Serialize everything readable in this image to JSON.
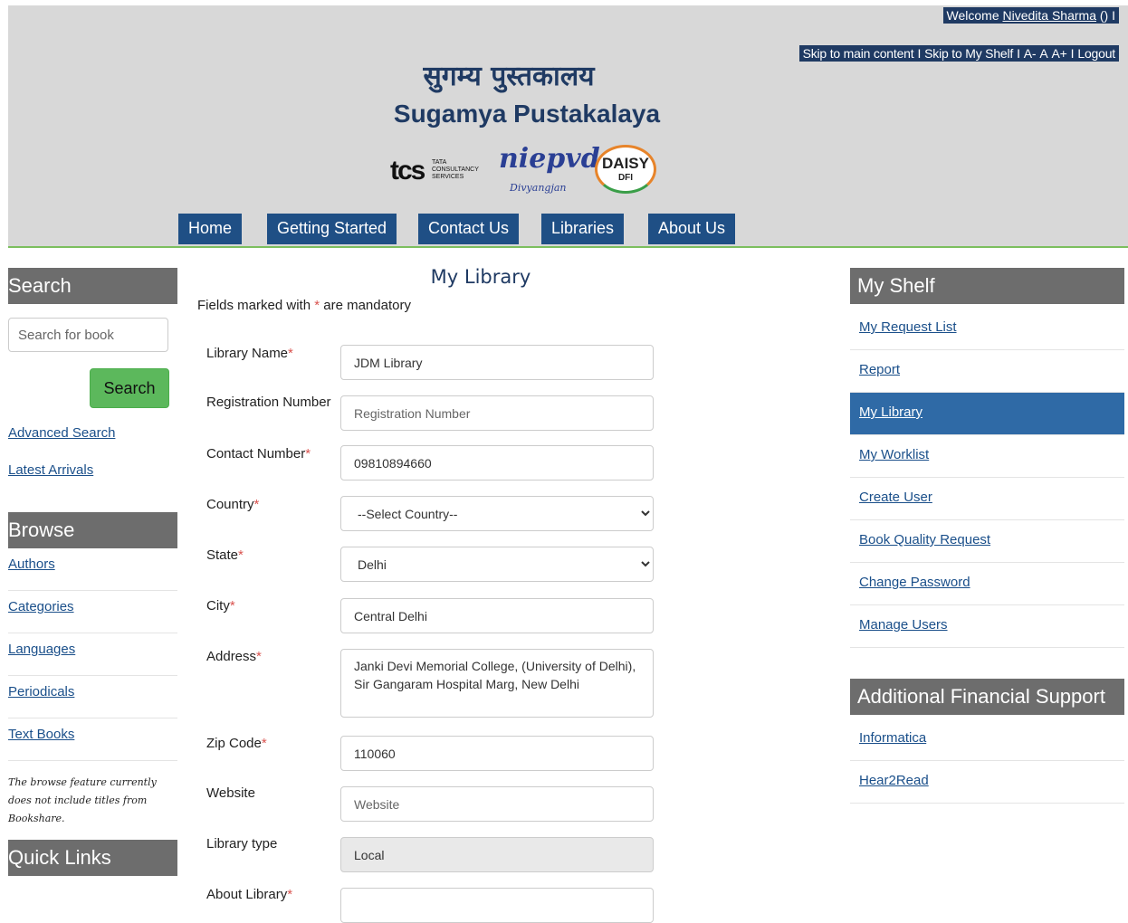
{
  "header": {
    "welcome_prefix": "Welcome",
    "user_name": "Nivedita Sharma",
    "welcome_suffix": "() I",
    "top_links": [
      "Skip to main content",
      "I",
      "Skip to My Shelf",
      "I",
      "A-",
      "A",
      "A+",
      "I",
      "Logout"
    ],
    "brand_hindi": "सुगम्य पुस्तकालय",
    "brand_english": "Sugamya Pustakalaya",
    "logos": {
      "tcs": "tcs",
      "tcs_sub": "TATA CONSULTANCY SERVICES",
      "niepvd": "niepvd",
      "niepvd_sub": "Divyangjan",
      "daisy": "DAISY",
      "daisy_sub": "DFI"
    },
    "nav": [
      "Home",
      "Getting Started",
      "Contact Us",
      "Libraries",
      "About Us"
    ]
  },
  "left": {
    "search_heading": "Search",
    "search_placeholder": "Search for book",
    "search_button": "Search",
    "advanced_search": "Advanced Search",
    "latest_arrivals": "Latest Arrivals",
    "browse_heading": "Browse",
    "browse_items": [
      "Authors",
      "Categories",
      "Languages",
      "Periodicals",
      "Text Books"
    ],
    "browse_note": "The browse feature currently does not include titles from Bookshare.",
    "quick_links_heading": "Quick Links"
  },
  "form": {
    "title": "My Library",
    "mandatory_prefix": "Fields marked with",
    "mandatory_star": "*",
    "mandatory_suffix": "are mandatory",
    "library_name_label": "Library Name",
    "library_name_value": "JDM Library",
    "registration_label": "Registration Number",
    "registration_placeholder": "Registration Number",
    "contact_label": "Contact Number",
    "contact_value": "09810894660",
    "country_label": "Country",
    "country_value": "--Select Country--",
    "state_label": "State",
    "state_value": "Delhi",
    "city_label": "City",
    "city_value": "Central Delhi",
    "address_label": "Address",
    "address_value": "Janki Devi Memorial College, (University of Delhi), Sir Gangaram Hospital Marg, New Delhi",
    "zip_label": "Zip Code",
    "zip_value": "110060",
    "website_label": "Website",
    "website_placeholder": "Website",
    "library_type_label": "Library type",
    "library_type_value": "Local",
    "about_label": "About Library"
  },
  "right": {
    "shelf_heading": "My Shelf",
    "shelf_items": [
      "My Request List",
      "Report",
      "My Library",
      "My Worklist",
      "Create User",
      "Book Quality Request",
      "Change Password",
      "Manage Users"
    ],
    "active_item": "My Library",
    "support_heading": "Additional Financial Support",
    "support_items": [
      "Informatica",
      "Hear2Read"
    ]
  },
  "colors": {
    "navy": "#1f3a63",
    "nav_button": "#1f4f85",
    "active_row": "#2f6aa6",
    "sidebar_heading": "#6d6d6d",
    "search_button": "#5cb85c",
    "required_star": "#d9534f",
    "header_rule": "#7bbf5e"
  }
}
